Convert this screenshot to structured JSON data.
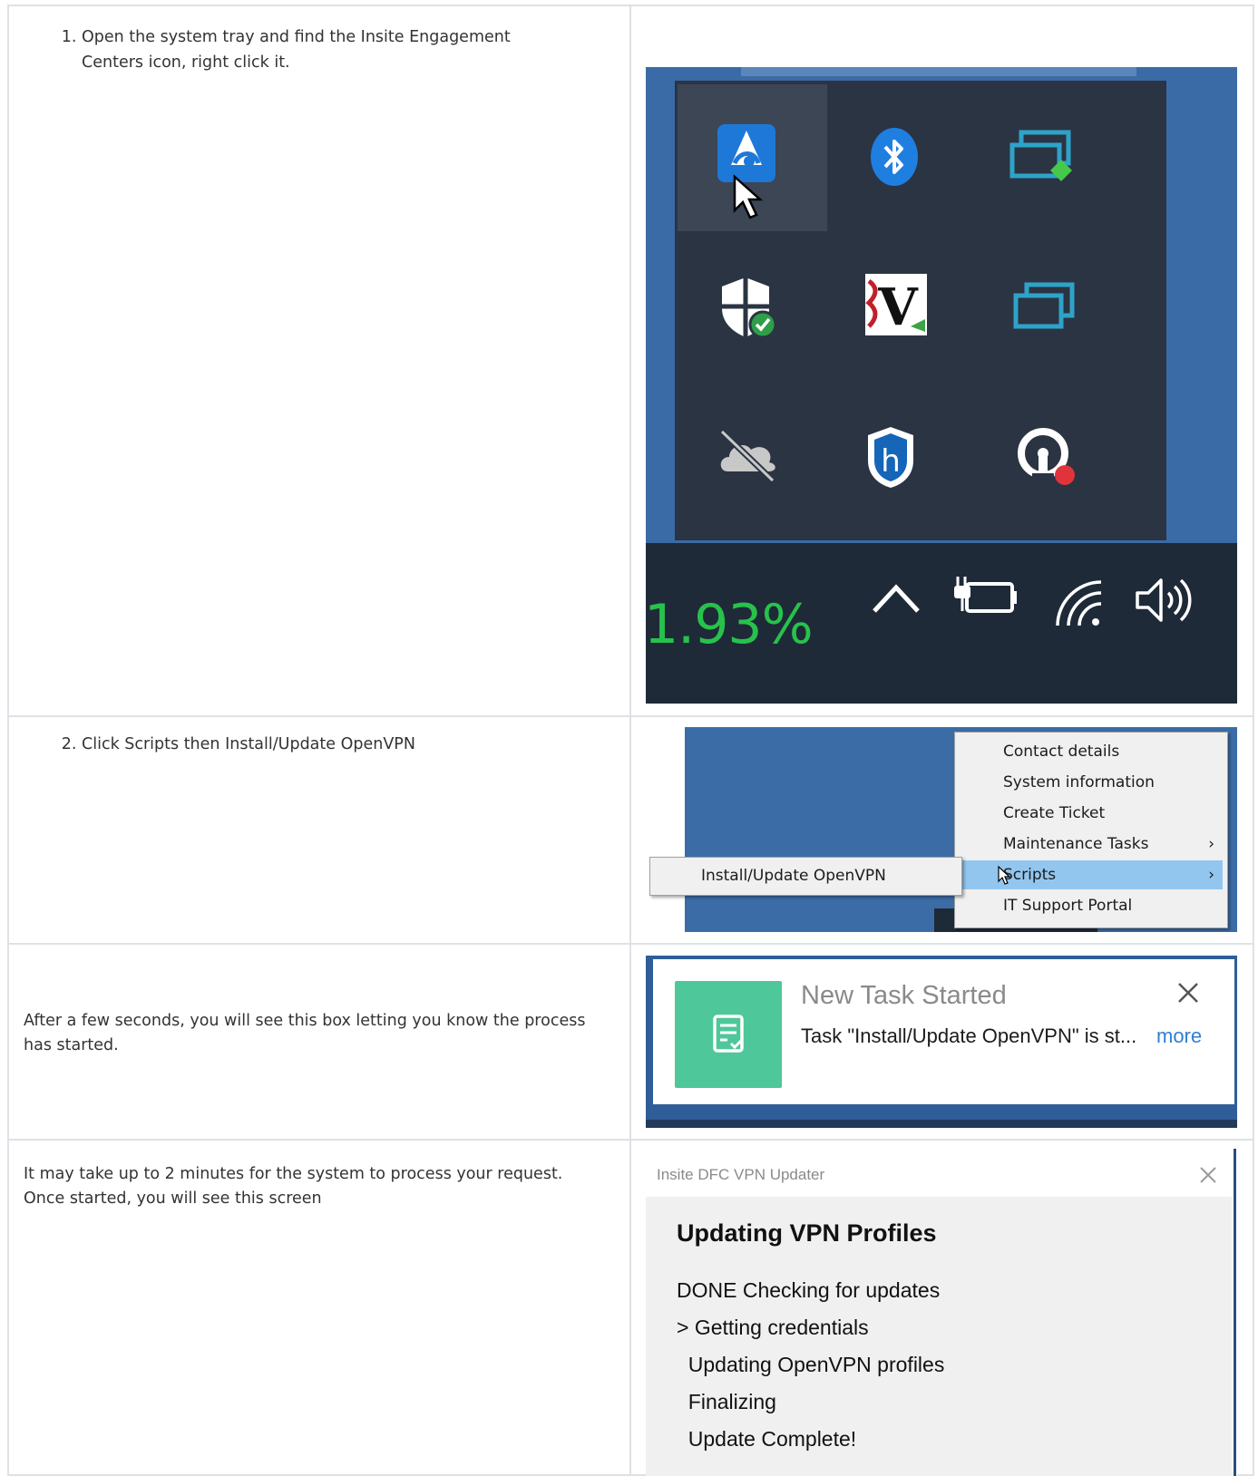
{
  "steps": [
    {
      "number": 1,
      "text": "Open the system tray and find the Insite Engagement Centers icon, right click it.",
      "screenshot": {
        "percentage": "1.93%",
        "icons": [
          "insite-engagement-centers-icon",
          "bluetooth-icon",
          "network-share-icon",
          "defender-shield-icon",
          "v-app-icon",
          "task-view-icon",
          "onedrive-off-icon",
          "h-shield-icon",
          "vpn-key-icon",
          "chevron-up-icon",
          "battery-plug-icon",
          "wifi-icon",
          "speaker-icon"
        ]
      }
    },
    {
      "number": 2,
      "text": "Click Scripts then Install/Update OpenVPN",
      "screenshot": {
        "menu_items": [
          "Contact details",
          "System information",
          "Create Ticket",
          "Maintenance Tasks",
          "Scripts",
          "IT Support Portal"
        ],
        "selected_item": "Scripts",
        "submenu_item": "Install/Update OpenVPN"
      }
    }
  ],
  "note_started": "After a few seconds, you will see this box letting you know the process has started.",
  "notification": {
    "title": "New Task Started",
    "message": "Task \"Install/Update OpenVPN\" is st...",
    "more": "more"
  },
  "note_wait": "It may take up to 2 minutes for the system to process your request. Once started, you will see this screen",
  "updater": {
    "window_title": "Insite DFC VPN Updater",
    "heading": "Updating VPN Profiles",
    "lines": [
      "DONE Checking for updates",
      "> Getting credentials",
      "  Updating OpenVPN profiles",
      "  Finalizing",
      "  Update Complete!"
    ]
  },
  "colors": {
    "border": "#dfe1e6",
    "tray_popup": "#2b3442",
    "taskbar": "#1f2a38",
    "percentage_green": "#27c24c",
    "menu_selection": "#92c6ef",
    "notification_tile": "#4ec79a",
    "link_blue": "#2f7fd0"
  }
}
